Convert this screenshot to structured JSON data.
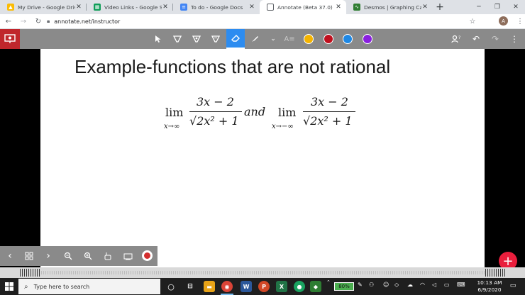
{
  "browser": {
    "tabs": [
      {
        "title": "My Drive - Google Drive",
        "color": "#4285f4"
      },
      {
        "title": "Video Links - Google Sheets",
        "color": "#0f9d58"
      },
      {
        "title": "To do - Google Docs",
        "color": "#4285f4"
      },
      {
        "title": "Annotate (Beta 37.0)",
        "color": "#5f6368"
      },
      {
        "title": "Desmos | Graphing Calculator",
        "color": "#2f7d32"
      }
    ],
    "close_glyph": "✕",
    "new_tab_glyph": "+",
    "url": "annotate.net/instructor",
    "avatar_letter": "A"
  },
  "annotate": {
    "colors": [
      "#f5b400",
      "#c0101e",
      "#1e88e5",
      "#8a1fe0"
    ]
  },
  "slide": {
    "title": "Example-functions that are not rational",
    "expr1": {
      "lim": "lim",
      "sub": "x→∞",
      "num": "3x − 2",
      "den": "√2x² + 1"
    },
    "and": "and",
    "expr2": {
      "lim": "lim",
      "sub": "x→−∞",
      "num": "3x − 2",
      "den": "√2x² + 1"
    }
  },
  "fab": {
    "label": "+"
  },
  "taskbar": {
    "search_placeholder": "Type here to search",
    "battery": "80%",
    "time": "10:13 AM",
    "date": "6/9/2020"
  }
}
